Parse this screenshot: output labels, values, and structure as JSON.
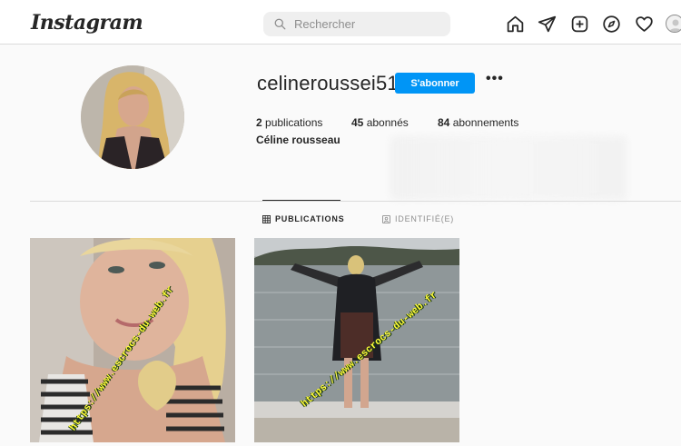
{
  "header": {
    "logo": "Instagram",
    "search_placeholder": "Rechercher"
  },
  "nav_icons": [
    "home-icon",
    "direct-icon",
    "new-post-icon",
    "explore-icon",
    "activity-icon",
    "profile-avatar"
  ],
  "profile": {
    "username": "celineroussei51",
    "follow_label": "S'abonner",
    "more_label": "•••",
    "publications_count": "2",
    "publications_label": "publications",
    "followers_count": "45",
    "followers_label": "abonnés",
    "following_count": "84",
    "following_label": "abonnements",
    "full_name": "Céline rousseau"
  },
  "tabs": [
    {
      "label": "PUBLICATIONS",
      "active": true,
      "icon": "grid-icon"
    },
    {
      "label": "IDENTIFIÉ(E)",
      "active": false,
      "icon": "tagged-icon"
    }
  ],
  "posts": [
    {
      "watermark": "https://www.escrocs-du-web.fr"
    },
    {
      "watermark": "https://www.escrocs-du-web.fr"
    }
  ],
  "colors": {
    "accent": "#0095f6",
    "background": "#fafafa",
    "watermark": "#fffb3a"
  }
}
